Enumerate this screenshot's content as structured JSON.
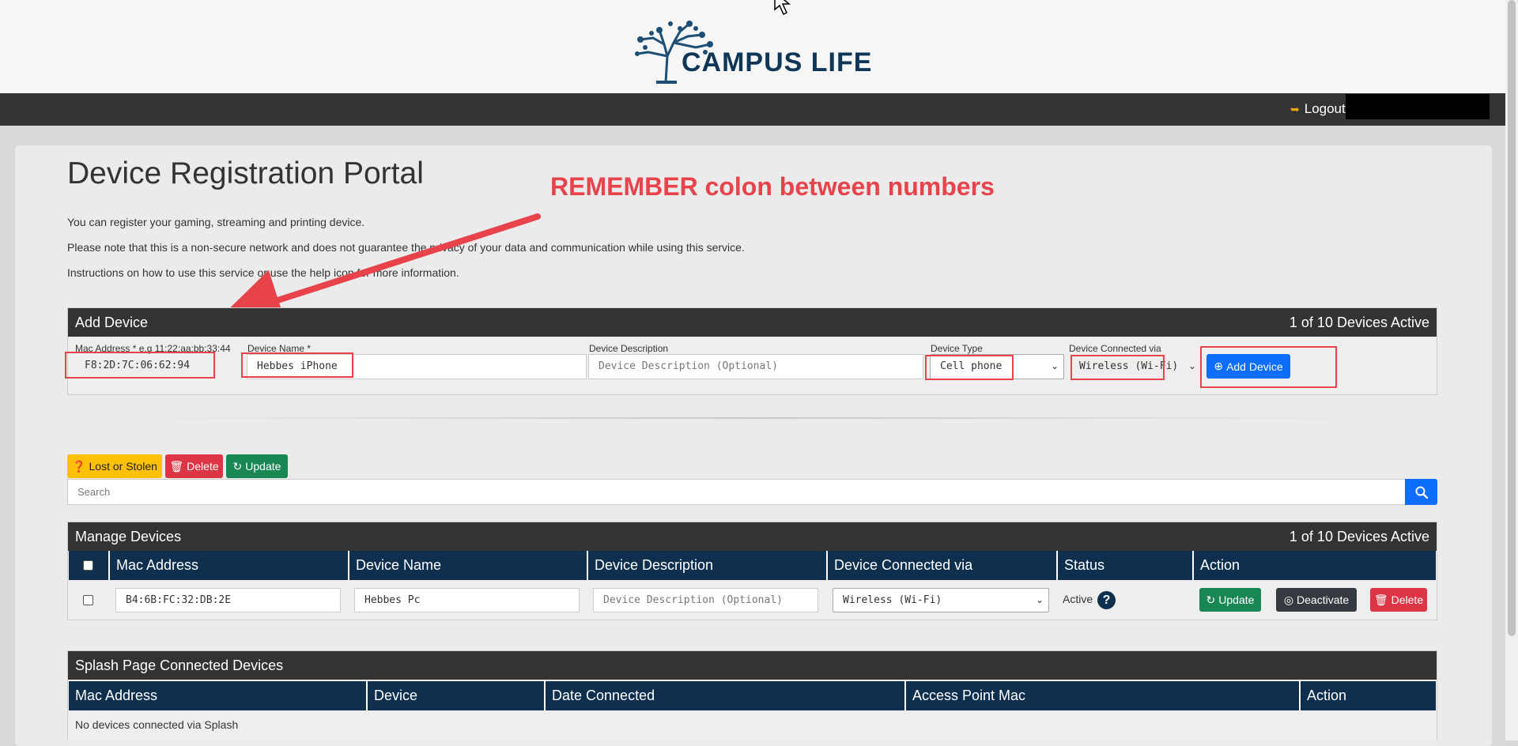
{
  "header": {
    "brand": "CAMPUS LIFE",
    "logout_label": "Logout"
  },
  "page": {
    "title": "Device Registration Portal",
    "intro_lines": [
      "You can register your gaming, streaming and printing device.",
      "Please note that this is a non-secure network and does not guarantee the privacy of your data and communication while using this service.",
      "Instructions on how to use this service or use the help icon for more information."
    ],
    "annotation": "REMEMBER colon between numbers"
  },
  "add_device": {
    "title": "Add Device",
    "count": "1 of 10 Devices Active",
    "mac_label": "Mac Address * e.g 11:22:aa:bb:33:44",
    "mac_value": "F8:2D:7C:06:62:94",
    "name_label": "Device Name *",
    "name_value": "Hebbes iPhone",
    "desc_label": "Device Description",
    "desc_placeholder": "Device Description (Optional)",
    "type_label": "Device Type",
    "type_value": "Cell phone",
    "via_label": "Device Connected via",
    "via_value": "Wireless (Wi-Fi)",
    "add_button": "Add Device"
  },
  "actions": {
    "lost_label": "Lost or Stolen",
    "delete_label": "Delete",
    "update_label": "Update",
    "search_placeholder": "Search"
  },
  "manage": {
    "title": "Manage Devices",
    "count": "1 of 10 Devices Active",
    "columns": [
      "Mac Address",
      "Device Name",
      "Device Description",
      "Device Connected via",
      "Status",
      "Action"
    ],
    "rows": [
      {
        "mac": "B4:6B:FC:32:DB:2E",
        "name": "Hebbes Pc",
        "desc_placeholder": "Device Description (Optional)",
        "via": "Wireless (Wi-Fi)",
        "status": "Active",
        "update_label": "Update",
        "deactivate_label": "Deactivate",
        "delete_label": "Delete"
      }
    ]
  },
  "splash": {
    "title": "Splash Page Connected Devices",
    "columns": [
      "Mac Address",
      "Device",
      "Date Connected",
      "Access Point Mac",
      "Action"
    ],
    "empty_text": "No devices connected via Splash"
  },
  "colors": {
    "accent_red": "#e8434b",
    "primary_blue": "#0d6efd",
    "table_header": "#0f2f4f",
    "card_header": "#333333",
    "warning": "#ffc107",
    "danger": "#dc3545",
    "success": "#198754"
  }
}
